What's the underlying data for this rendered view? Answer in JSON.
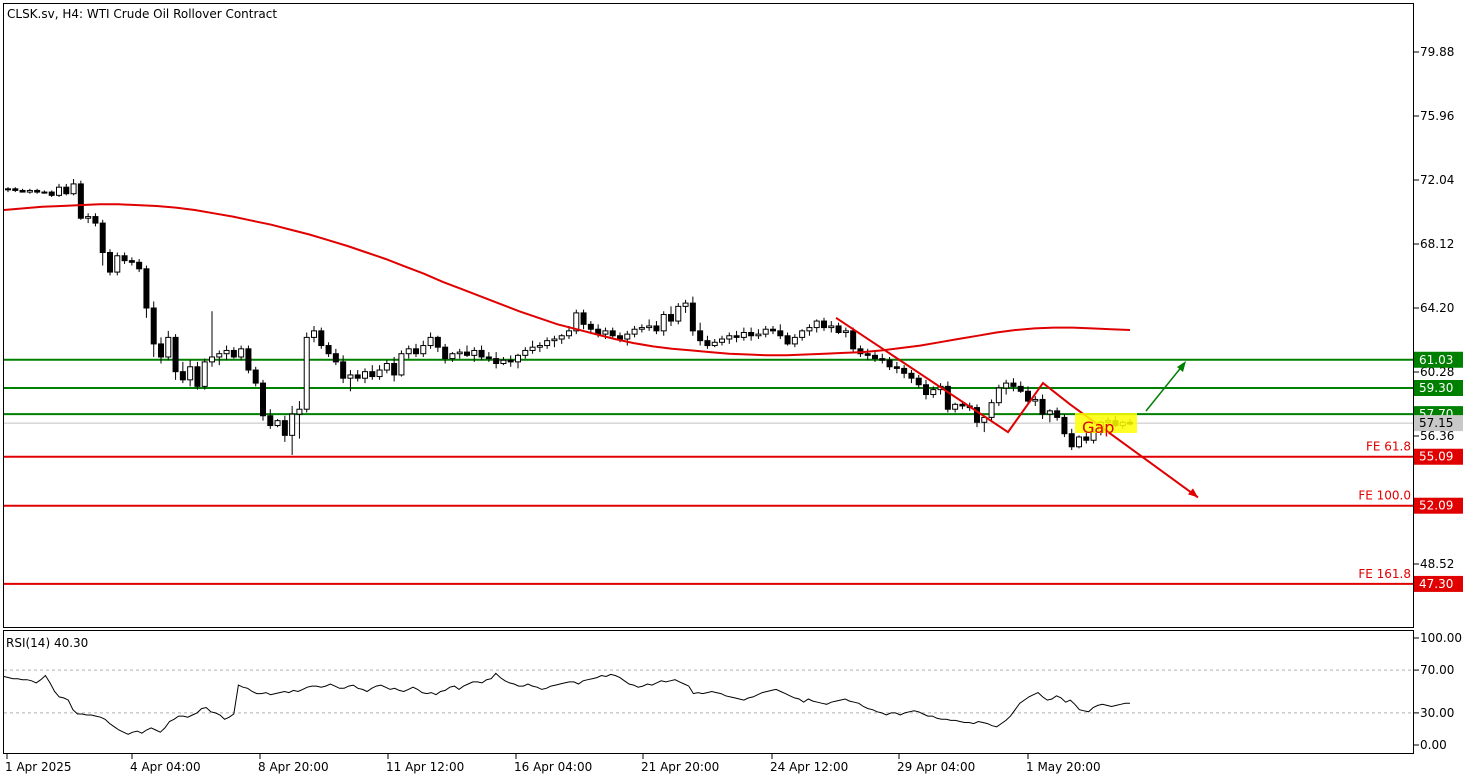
{
  "header": {
    "title": "CLSK.sv, H4:  WTI Crude Oil Rollover Contract",
    "rsi_label": "RSI(14) 40.30"
  },
  "chart_data": {
    "type": "candlestick",
    "y_ticks": [
      "79.88",
      "75.96",
      "72.04",
      "68.12",
      "64.20",
      "60.28",
      "56.36",
      "48.52"
    ],
    "y_tick_values": [
      79.88,
      75.96,
      72.04,
      68.12,
      64.2,
      60.28,
      56.36,
      48.52
    ],
    "ylim": [
      45.3,
      83.6
    ],
    "x_ticks": [
      "1 Apr 2025",
      "4 Apr 04:00",
      "8 Apr 20:00",
      "11 Apr 12:00",
      "16 Apr 04:00",
      "21 Apr 20:00",
      "24 Apr 12:00",
      "29 Apr 04:00",
      "1 May 20:00"
    ],
    "levels": [
      {
        "value": 61.03,
        "label": "61.03",
        "color": "#008000"
      },
      {
        "value": 59.3,
        "label": "59.30",
        "color": "#008000"
      },
      {
        "value": 57.7,
        "label": "57.70",
        "color": "#008000"
      },
      {
        "value": 55.09,
        "label": "55.09",
        "color": "#e00000",
        "fe": "FE 61.8"
      },
      {
        "value": 52.09,
        "label": "52.09",
        "color": "#e00000",
        "fe": "FE 100.0"
      },
      {
        "value": 47.3,
        "label": "47.30",
        "color": "#e00000",
        "fe": "FE 161.8"
      }
    ],
    "current_price_marker": "57.15",
    "annotation": "Gap",
    "moving_average_color": "#e00000",
    "candles": [
      [
        71.5,
        71.6,
        71.3,
        71.5
      ],
      [
        71.5,
        71.6,
        71.3,
        71.4
      ],
      [
        71.4,
        71.5,
        71.3,
        71.3
      ],
      [
        71.3,
        71.5,
        71.2,
        71.4
      ],
      [
        71.4,
        71.5,
        71.2,
        71.3
      ],
      [
        71.3,
        71.4,
        71.2,
        71.3
      ],
      [
        71.3,
        71.4,
        71.0,
        71.1
      ],
      [
        71.1,
        71.8,
        71.0,
        71.6
      ],
      [
        71.6,
        71.8,
        71.1,
        71.2
      ],
      [
        71.2,
        72.1,
        71.1,
        71.8
      ],
      [
        71.8,
        72.0,
        69.6,
        69.7
      ],
      [
        69.7,
        70.0,
        69.4,
        69.8
      ],
      [
        69.8,
        70.0,
        69.2,
        69.4
      ],
      [
        69.4,
        69.6,
        66.8,
        67.6
      ],
      [
        67.6,
        67.8,
        66.2,
        66.4
      ],
      [
        66.4,
        67.6,
        66.2,
        67.4
      ],
      [
        67.4,
        67.6,
        66.9,
        67.1
      ],
      [
        67.1,
        67.3,
        66.8,
        67.0
      ],
      [
        67.0,
        67.2,
        66.4,
        66.6
      ],
      [
        66.6,
        66.8,
        63.6,
        64.2
      ],
      [
        64.2,
        64.6,
        61.2,
        62.0
      ],
      [
        62.0,
        62.4,
        60.8,
        61.2
      ],
      [
        61.2,
        62.8,
        61.0,
        62.4
      ],
      [
        62.4,
        62.6,
        59.8,
        60.3
      ],
      [
        60.3,
        60.9,
        59.6,
        59.8
      ],
      [
        59.8,
        61.0,
        59.4,
        60.6
      ],
      [
        60.6,
        60.9,
        59.2,
        59.4
      ],
      [
        59.4,
        61.1,
        59.2,
        60.9
      ],
      [
        60.9,
        64.0,
        60.6,
        61.2
      ],
      [
        61.2,
        61.6,
        60.7,
        61.4
      ],
      [
        61.4,
        61.9,
        61.0,
        61.6
      ],
      [
        61.6,
        61.8,
        61.1,
        61.2
      ],
      [
        61.2,
        61.9,
        61.0,
        61.7
      ],
      [
        61.7,
        61.9,
        60.2,
        60.4
      ],
      [
        60.4,
        60.6,
        59.4,
        59.6
      ],
      [
        59.6,
        59.8,
        57.3,
        57.6
      ],
      [
        57.6,
        58.0,
        56.8,
        57.0
      ],
      [
        57.0,
        57.4,
        56.9,
        57.3
      ],
      [
        57.3,
        57.6,
        56.0,
        56.4
      ],
      [
        56.4,
        58.2,
        55.2,
        57.7
      ],
      [
        57.7,
        58.5,
        56.2,
        58.0
      ],
      [
        58.0,
        62.7,
        57.8,
        62.4
      ],
      [
        62.4,
        63.1,
        62.1,
        62.8
      ],
      [
        62.8,
        63.0,
        61.7,
        61.9
      ],
      [
        61.9,
        62.1,
        61.2,
        61.4
      ],
      [
        61.4,
        61.7,
        60.7,
        60.9
      ],
      [
        60.9,
        61.3,
        59.6,
        59.9
      ],
      [
        59.9,
        60.4,
        59.1,
        60.1
      ],
      [
        60.1,
        60.4,
        59.7,
        59.9
      ],
      [
        59.9,
        60.5,
        59.6,
        60.3
      ],
      [
        60.3,
        60.7,
        59.8,
        60.0
      ],
      [
        60.0,
        60.7,
        59.8,
        60.4
      ],
      [
        60.4,
        61.0,
        60.2,
        60.8
      ],
      [
        60.8,
        61.2,
        59.7,
        60.1
      ],
      [
        60.1,
        61.6,
        60.0,
        61.4
      ],
      [
        61.4,
        61.9,
        61.1,
        61.7
      ],
      [
        61.7,
        62.0,
        61.2,
        61.4
      ],
      [
        61.4,
        62.2,
        61.2,
        61.9
      ],
      [
        61.9,
        62.7,
        61.7,
        62.4
      ],
      [
        62.4,
        62.5,
        61.5,
        61.8
      ],
      [
        61.8,
        62.0,
        60.8,
        61.1
      ],
      [
        61.1,
        61.5,
        60.9,
        61.4
      ],
      [
        61.4,
        61.7,
        61.1,
        61.5
      ],
      [
        61.5,
        61.9,
        61.2,
        61.3
      ],
      [
        61.3,
        61.8,
        60.9,
        61.6
      ],
      [
        61.6,
        61.9,
        61.0,
        61.2
      ],
      [
        61.2,
        61.5,
        60.9,
        61.1
      ],
      [
        61.1,
        61.5,
        60.5,
        60.8
      ],
      [
        60.8,
        61.2,
        60.7,
        61.0
      ],
      [
        61.0,
        61.3,
        60.6,
        60.9
      ],
      [
        60.9,
        61.4,
        60.5,
        61.3
      ],
      [
        61.3,
        61.8,
        61.1,
        61.6
      ],
      [
        61.6,
        62.2,
        61.4,
        61.8
      ],
      [
        61.8,
        62.1,
        61.5,
        61.9
      ],
      [
        61.9,
        62.4,
        61.7,
        62.2
      ],
      [
        62.2,
        62.5,
        61.8,
        62.3
      ],
      [
        62.3,
        62.6,
        62.0,
        62.5
      ],
      [
        62.5,
        63.1,
        62.3,
        62.8
      ],
      [
        62.8,
        64.1,
        62.6,
        63.9
      ],
      [
        63.9,
        64.1,
        62.9,
        63.2
      ],
      [
        63.2,
        63.4,
        62.6,
        62.9
      ],
      [
        62.9,
        63.2,
        62.4,
        62.6
      ],
      [
        62.6,
        63.0,
        62.3,
        62.8
      ],
      [
        62.8,
        63.0,
        62.4,
        62.5
      ],
      [
        62.5,
        62.7,
        62.1,
        62.3
      ],
      [
        62.3,
        62.8,
        61.9,
        62.6
      ],
      [
        62.6,
        63.1,
        62.4,
        62.9
      ],
      [
        62.9,
        63.2,
        62.7,
        63.0
      ],
      [
        63.0,
        63.5,
        62.8,
        63.1
      ],
      [
        63.1,
        63.4,
        62.6,
        62.8
      ],
      [
        62.8,
        64.0,
        62.5,
        63.8
      ],
      [
        63.8,
        64.3,
        63.1,
        63.4
      ],
      [
        63.4,
        64.5,
        63.2,
        64.3
      ],
      [
        64.3,
        64.7,
        63.9,
        64.5
      ],
      [
        64.5,
        64.9,
        62.5,
        62.8
      ],
      [
        62.8,
        63.3,
        61.9,
        62.2
      ],
      [
        62.2,
        62.5,
        61.7,
        61.9
      ],
      [
        61.9,
        62.3,
        61.8,
        62.1
      ],
      [
        62.1,
        62.5,
        61.9,
        62.3
      ],
      [
        62.3,
        62.7,
        62.0,
        62.5
      ],
      [
        62.5,
        62.8,
        62.1,
        62.4
      ],
      [
        62.4,
        63.0,
        62.2,
        62.7
      ],
      [
        62.7,
        63.0,
        62.2,
        62.5
      ],
      [
        62.5,
        62.9,
        62.3,
        62.6
      ],
      [
        62.6,
        63.1,
        62.4,
        62.9
      ],
      [
        62.9,
        63.1,
        62.6,
        62.8
      ],
      [
        62.8,
        63.2,
        62.3,
        62.5
      ],
      [
        62.5,
        62.7,
        61.9,
        62.0
      ],
      [
        62.0,
        62.6,
        61.8,
        62.4
      ],
      [
        62.4,
        62.9,
        62.2,
        62.8
      ],
      [
        62.8,
        63.2,
        62.5,
        63.0
      ],
      [
        63.0,
        63.5,
        62.7,
        63.4
      ],
      [
        63.4,
        63.6,
        62.8,
        63.0
      ],
      [
        63.0,
        63.4,
        62.7,
        63.1
      ],
      [
        63.1,
        63.3,
        62.6,
        62.7
      ],
      [
        62.7,
        63.0,
        62.4,
        62.8
      ],
      [
        62.8,
        63.0,
        61.5,
        61.7
      ],
      [
        61.7,
        61.9,
        61.2,
        61.4
      ],
      [
        61.4,
        61.7,
        61.0,
        61.3
      ],
      [
        61.3,
        61.5,
        60.9,
        61.1
      ],
      [
        61.1,
        61.4,
        60.8,
        61.0
      ],
      [
        61.0,
        61.2,
        60.4,
        60.6
      ],
      [
        60.6,
        60.9,
        60.2,
        60.5
      ],
      [
        60.5,
        60.7,
        59.9,
        60.2
      ],
      [
        60.2,
        60.4,
        59.6,
        59.9
      ],
      [
        59.9,
        60.1,
        59.3,
        59.5
      ],
      [
        59.5,
        59.8,
        58.6,
        58.9
      ],
      [
        58.9,
        59.4,
        58.7,
        59.2
      ],
      [
        59.2,
        59.6,
        58.9,
        59.4
      ],
      [
        59.4,
        59.7,
        57.8,
        58.0
      ],
      [
        58.0,
        58.4,
        57.8,
        58.3
      ],
      [
        58.3,
        58.5,
        58.0,
        58.2
      ],
      [
        58.2,
        58.4,
        57.9,
        58.1
      ],
      [
        58.1,
        58.3,
        56.9,
        57.2
      ],
      [
        57.2,
        57.6,
        56.6,
        57.5
      ],
      [
        57.5,
        58.6,
        57.3,
        58.4
      ],
      [
        58.4,
        59.5,
        58.2,
        59.3
      ],
      [
        59.3,
        59.8,
        58.9,
        59.6
      ],
      [
        59.6,
        59.9,
        59.1,
        59.4
      ],
      [
        59.4,
        59.7,
        59.0,
        59.1
      ],
      [
        59.1,
        59.4,
        58.3,
        58.5
      ],
      [
        58.5,
        58.8,
        58.2,
        58.6
      ],
      [
        58.6,
        58.9,
        57.4,
        57.7
      ],
      [
        57.7,
        58.0,
        57.2,
        57.9
      ],
      [
        57.9,
        58.1,
        57.3,
        57.5
      ],
      [
        57.5,
        57.7,
        56.3,
        56.5
      ],
      [
        56.5,
        56.8,
        55.5,
        55.7
      ],
      [
        55.7,
        56.4,
        55.6,
        56.3
      ],
      [
        56.3,
        56.7,
        55.9,
        56.1
      ],
      [
        56.1,
        56.9,
        55.9,
        56.6
      ],
      [
        56.6,
        57.3,
        56.4,
        57.2
      ],
      [
        57.2,
        57.5,
        57.0,
        57.3
      ],
      [
        57.3,
        57.6,
        56.9,
        57.0
      ],
      [
        57.0,
        57.3,
        56.8,
        57.2
      ],
      [
        57.2,
        57.4,
        57.0,
        57.1
      ]
    ],
    "ma": [
      70.2,
      70.3,
      70.4,
      70.45,
      70.5,
      70.55,
      70.55,
      70.5,
      70.45,
      70.35,
      70.2,
      70.0,
      69.8,
      69.55,
      69.3,
      69.0,
      68.7,
      68.35,
      68.0,
      67.6,
      67.2,
      66.75,
      66.3,
      65.8,
      65.35,
      64.9,
      64.45,
      64.0,
      63.6,
      63.2,
      62.9,
      62.6,
      62.3,
      62.05,
      61.85,
      61.7,
      61.6,
      61.5,
      61.4,
      61.35,
      61.3,
      61.3,
      61.35,
      61.4,
      61.45,
      61.5,
      61.6,
      61.75,
      61.9,
      62.1,
      62.3,
      62.5,
      62.7,
      62.85,
      62.95,
      63.0,
      63.0,
      62.95,
      62.9,
      62.85
    ],
    "rsi": {
      "type": "line",
      "y_ticks": [
        "100.00",
        "70.00",
        "30.00",
        "0.00"
      ],
      "y_tick_values": [
        100,
        70,
        30,
        0
      ],
      "ylim": [
        -2,
        108
      ],
      "levels": [
        70,
        30
      ],
      "values": [
        64,
        63,
        62,
        62,
        61,
        61,
        60,
        58,
        61,
        65,
        58,
        50,
        45,
        44,
        42,
        33,
        29,
        29,
        28,
        28,
        27,
        26,
        24,
        20,
        17,
        14,
        12,
        10,
        12,
        13,
        11,
        14,
        16,
        14,
        12,
        16,
        22,
        24,
        27,
        27,
        26,
        28,
        30,
        34,
        35,
        31,
        30,
        28,
        24,
        26,
        29,
        56,
        54,
        53,
        50,
        48,
        48,
        49,
        47,
        48,
        49,
        50,
        49,
        51,
        50,
        52,
        54,
        55,
        55,
        54,
        55,
        57,
        55,
        53,
        53,
        55,
        56,
        53,
        52,
        50,
        53,
        55,
        56,
        54,
        52,
        53,
        51,
        50,
        52,
        54,
        52,
        49,
        48,
        49,
        47,
        50,
        51,
        54,
        55,
        52,
        55,
        57,
        59,
        59,
        58,
        61,
        62,
        67,
        63,
        60,
        58,
        57,
        55,
        55,
        57,
        55,
        54,
        52,
        53,
        55,
        56,
        57,
        58,
        59,
        59,
        57,
        60,
        61,
        62,
        63,
        65,
        64,
        66,
        65,
        63,
        60,
        57,
        56,
        54,
        55,
        57,
        56,
        58,
        60,
        59,
        60,
        61,
        59,
        57,
        55,
        48,
        49,
        48,
        49,
        50,
        49,
        48,
        46,
        45,
        44,
        43,
        42,
        44,
        45,
        47,
        49,
        50,
        51,
        52,
        50,
        48,
        46,
        44,
        43,
        40,
        43,
        41,
        40,
        39,
        38,
        40,
        41,
        42,
        43,
        41,
        40,
        39,
        36,
        34,
        33,
        31,
        30,
        28,
        30,
        30,
        28,
        30,
        31,
        32,
        31,
        29,
        27,
        27,
        25,
        24,
        24,
        23,
        23,
        22,
        21,
        21,
        20,
        22,
        21,
        20,
        18,
        17,
        20,
        23,
        27,
        33,
        39,
        42,
        45,
        47,
        49,
        45,
        42,
        43,
        46,
        44,
        40,
        42,
        38,
        33,
        32,
        31,
        35,
        37,
        38,
        37,
        36,
        37,
        38,
        39,
        39
      ]
    }
  }
}
